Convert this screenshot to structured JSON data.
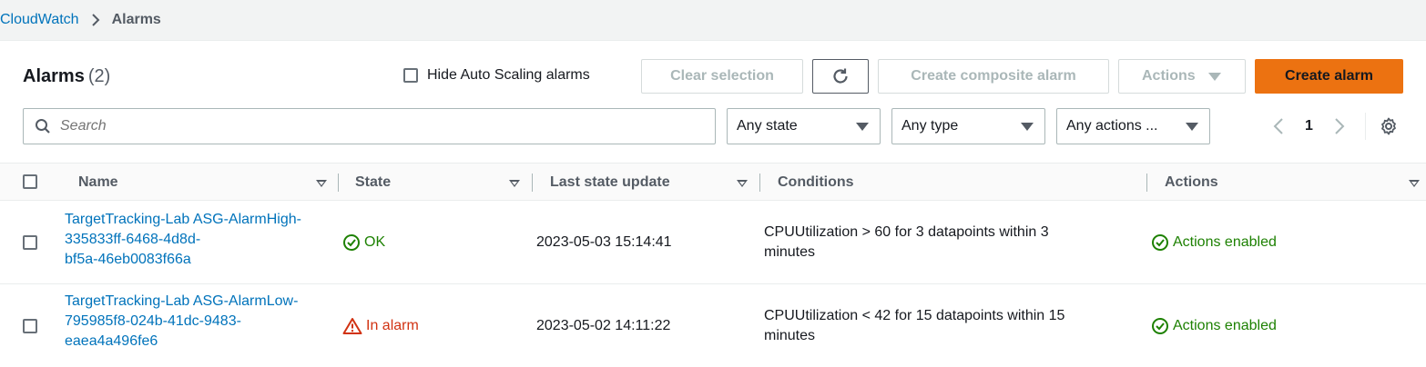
{
  "breadcrumb": {
    "root": "CloudWatch",
    "current": "Alarms"
  },
  "header": {
    "title": "Alarms",
    "count": "(2)",
    "hide_autoscaling_label": "Hide Auto Scaling alarms",
    "clear_selection": "Clear selection",
    "create_composite": "Create composite alarm",
    "actions": "Actions",
    "create_alarm": "Create alarm"
  },
  "filters": {
    "search_placeholder": "Search",
    "state": "Any state",
    "type": "Any type",
    "actions": "Any actions ...",
    "page": "1"
  },
  "columns": {
    "name": "Name",
    "state": "State",
    "last_update": "Last state update",
    "conditions": "Conditions",
    "actions": "Actions"
  },
  "rows": [
    {
      "name_line1": "TargetTracking-Lab ASG-AlarmHigh-",
      "name_line2": "335833ff-6468-4d8d-",
      "name_line3": "bf5a-46eb0083f66a",
      "state": "OK",
      "last_update": "2023-05-03 15:14:41",
      "condition_line1": "CPUUtilization > 60 for 3 datapoints within 3",
      "condition_line2": "minutes",
      "actions": "Actions enabled"
    },
    {
      "name_line1": "TargetTracking-Lab ASG-AlarmLow-",
      "name_line2": "795985f8-024b-41dc-9483-",
      "name_line3": "eaea4a496fe6",
      "state": "In alarm",
      "last_update": "2023-05-02 14:11:22",
      "condition_line1": "CPUUtilization < 42 for 15 datapoints within 15",
      "condition_line2": "minutes",
      "actions": "Actions enabled"
    }
  ],
  "colors": {
    "link": "#0073bb",
    "ok": "#1d8102",
    "alarm": "#d13212",
    "primary": "#ec7211"
  }
}
